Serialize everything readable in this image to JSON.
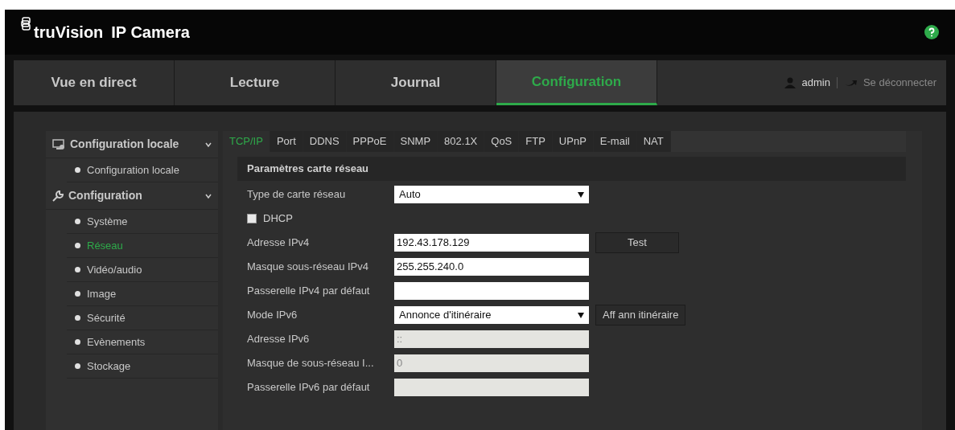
{
  "header": {
    "brand": "truVision",
    "title": "IP Camera"
  },
  "nav": [
    {
      "label": "Vue en direct",
      "selected": false
    },
    {
      "label": "Lecture",
      "selected": false
    },
    {
      "label": "Journal",
      "selected": false
    },
    {
      "label": "Configuration",
      "selected": true
    }
  ],
  "user": {
    "name": "admin",
    "logout": "Se déconnecter"
  },
  "sidebar": [
    {
      "label": "Configuration locale",
      "expanded": true,
      "children": [
        {
          "label": "Configuration locale",
          "selected": false
        }
      ]
    },
    {
      "label": "Configuration",
      "expanded": true,
      "children": [
        {
          "label": "Système",
          "selected": false
        },
        {
          "label": "Réseau",
          "selected": true
        },
        {
          "label": "Vidéo/audio",
          "selected": false
        },
        {
          "label": "Image",
          "selected": false
        },
        {
          "label": "Sécurité",
          "selected": false
        },
        {
          "label": "Evènements",
          "selected": false
        },
        {
          "label": "Stockage",
          "selected": false
        }
      ]
    }
  ],
  "tabs": [
    {
      "label": "TCP/IP",
      "selected": true
    },
    {
      "label": "Port",
      "selected": false
    },
    {
      "label": "DDNS",
      "selected": false
    },
    {
      "label": "PPPoE",
      "selected": false
    },
    {
      "label": "SNMP",
      "selected": false
    },
    {
      "label": "802.1X",
      "selected": false
    },
    {
      "label": "QoS",
      "selected": false
    },
    {
      "label": "FTP",
      "selected": false
    },
    {
      "label": "UPnP",
      "selected": false
    },
    {
      "label": "E-mail",
      "selected": false
    },
    {
      "label": "NAT",
      "selected": false
    }
  ],
  "section_title": "Paramètres carte réseau",
  "fields": [
    {
      "kind": "select",
      "label": "Type de carte réseau",
      "value": "Auto",
      "disabled": false
    },
    {
      "kind": "checkbox",
      "label": "DHCP",
      "checked": false
    },
    {
      "kind": "input",
      "label": "Adresse IPv4",
      "value": "192.43.178.129",
      "disabled": false,
      "button": "Test"
    },
    {
      "kind": "input",
      "label": "Masque sous-réseau IPv4",
      "value": "255.255.240.0",
      "disabled": false
    },
    {
      "kind": "input",
      "label": "Passerelle IPv4 par défaut",
      "disabled": false
    },
    {
      "kind": "select",
      "label": "Mode IPv6",
      "value": "Annonce d'itinéraire",
      "disabled": false,
      "button": "Aff ann itinéraire"
    },
    {
      "kind": "input",
      "label": "Adresse IPv6",
      "value": "::",
      "disabled": true
    },
    {
      "kind": "input",
      "label": "Masque de sous-réseau I...",
      "value": "0",
      "disabled": true
    },
    {
      "kind": "input",
      "label": "Passerelle IPv6 par défaut",
      "disabled": true
    }
  ]
}
